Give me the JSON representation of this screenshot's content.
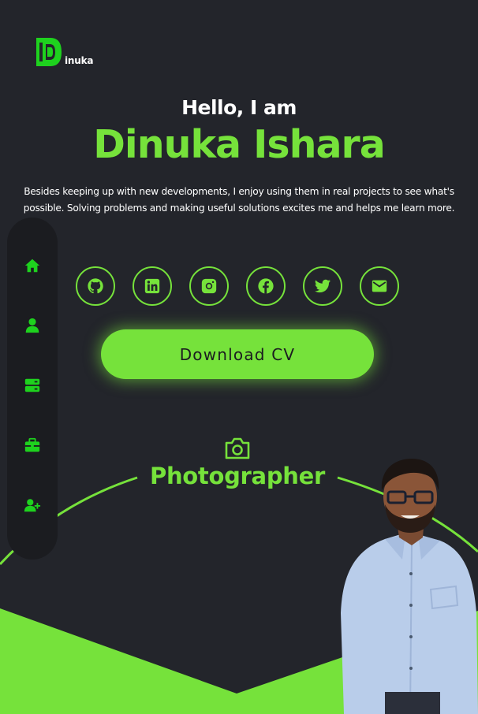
{
  "brand": {
    "logo_text": "inuka"
  },
  "hero": {
    "greeting": "Hello, I am",
    "name": "Dinuka Ishara",
    "bio": "Besides keeping up with new developments, I enjoy using them in real projects to see what's possible. Solving problems and making useful solutions excites me and helps me learn more."
  },
  "nav": {
    "items": [
      {
        "icon": "home-icon"
      },
      {
        "icon": "user-icon"
      },
      {
        "icon": "server-icon"
      },
      {
        "icon": "briefcase-icon"
      },
      {
        "icon": "user-plus-icon"
      }
    ]
  },
  "socials": [
    {
      "icon": "github-icon"
    },
    {
      "icon": "linkedin-icon"
    },
    {
      "icon": "instagram-icon"
    },
    {
      "icon": "facebook-icon"
    },
    {
      "icon": "twitter-icon"
    },
    {
      "icon": "email-icon"
    }
  ],
  "cta": {
    "download_label": "Download CV"
  },
  "role": {
    "icon": "camera-icon",
    "label": "Photographer"
  },
  "colors": {
    "accent": "#76e23b",
    "background": "#23252b",
    "sidebar": "#1b1c20"
  }
}
